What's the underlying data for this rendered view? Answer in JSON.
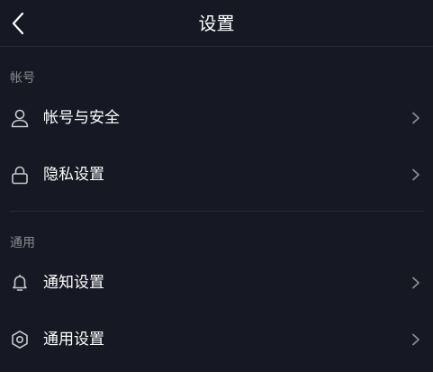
{
  "header": {
    "title": "设置",
    "back_icon": "chevron-left-icon"
  },
  "sections": [
    {
      "title": "帐号",
      "items": [
        {
          "label": "帐号与安全",
          "icon": "user-icon"
        },
        {
          "label": "隐私设置",
          "icon": "lock-icon"
        }
      ]
    },
    {
      "title": "通用",
      "items": [
        {
          "label": "通知设置",
          "icon": "bell-icon"
        },
        {
          "label": "通用设置",
          "icon": "gear-icon"
        }
      ]
    }
  ],
  "colors": {
    "background": "#161823",
    "text_primary": "#ffffff",
    "text_secondary": "#8a8b91",
    "divider": "#2a2c38",
    "icon": "#c8c9cc",
    "chevron": "#8a8b91"
  }
}
